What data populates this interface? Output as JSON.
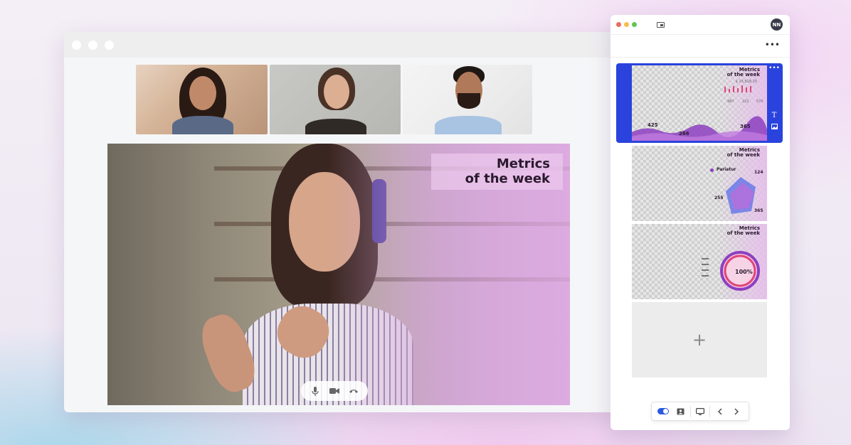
{
  "main_video": {
    "slide_title_line1": "Metrics",
    "slide_title_line2": "of the week",
    "controls": [
      "microphone-icon",
      "camera-icon",
      "hang-up-icon"
    ]
  },
  "participants": [
    {
      "name": "participant-1"
    },
    {
      "name": "participant-2"
    },
    {
      "name": "participant-3"
    }
  ],
  "panel": {
    "avatar_initials": "NN",
    "more_label": "•••",
    "slides": [
      {
        "title_line1": "Metrics",
        "title_line2": "of the week",
        "values": [
          "425",
          "266",
          "365"
        ],
        "small_values": [
          "987",
          "221",
          "570"
        ],
        "amount": "$ 15,618.25"
      },
      {
        "title_line1": "Metrics",
        "title_line2": "of the week",
        "legend": "Pariatur",
        "values": [
          "124",
          "255",
          "365"
        ]
      },
      {
        "title_line1": "Metrics",
        "title_line2": "of the week",
        "percent": "100%"
      }
    ],
    "add_label": "+"
  },
  "colors": {
    "accent": "#2a43dd",
    "slide_tint": "#e6bfeb",
    "toggle": "#2a5bdf"
  }
}
